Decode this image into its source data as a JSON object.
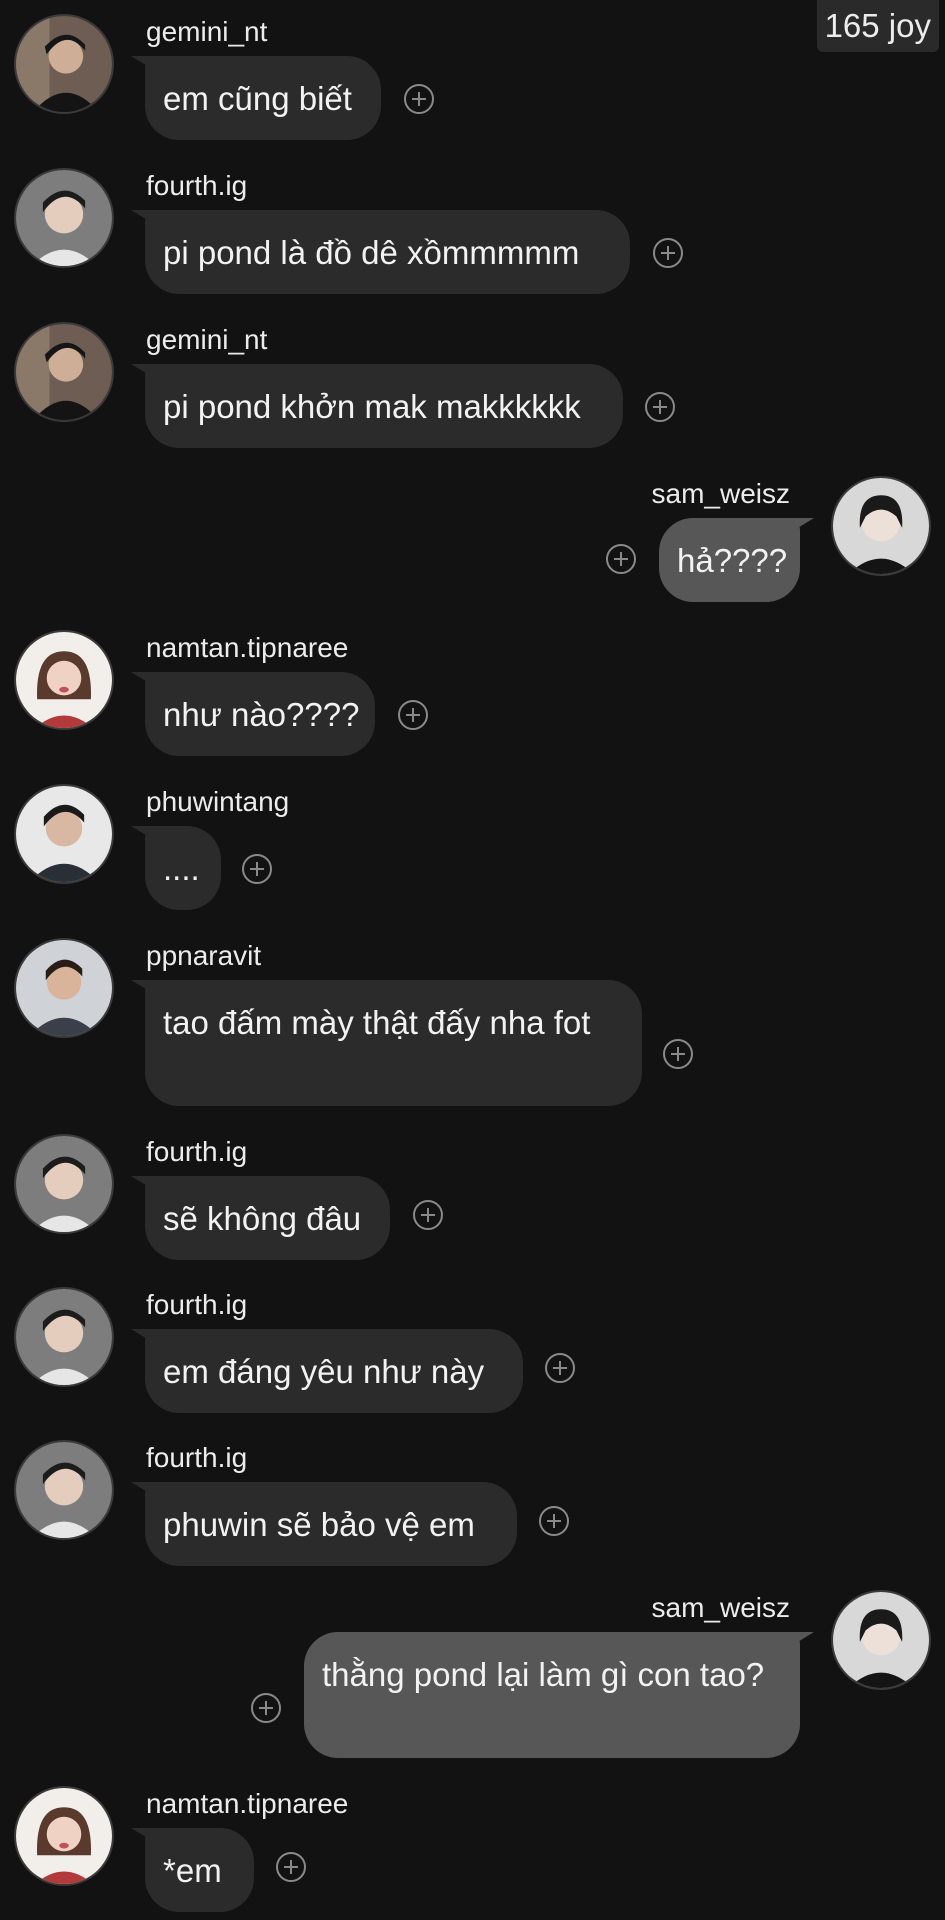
{
  "badge": "165 joy",
  "messages": [
    {
      "user": "gemini_nt",
      "text": "em cũng biết"
    },
    {
      "user": "fourth.ig",
      "text": "pi pond là đồ dê xồmmmmm"
    },
    {
      "user": "gemini_nt",
      "text": "pi pond khởn mak makkkkkk"
    },
    {
      "user": "sam_weisz",
      "text": "hả????"
    },
    {
      "user": "namtan.tipnaree",
      "text": "như nào????"
    },
    {
      "user": "phuwintang",
      "text": "...."
    },
    {
      "user": "ppnaravit",
      "text": "tao đấm mày thật đấy nha fot"
    },
    {
      "user": "fourth.ig",
      "text": "sẽ không đâu"
    },
    {
      "user": "fourth.ig",
      "text": "em đáng yêu như này"
    },
    {
      "user": "fourth.ig",
      "text": "phuwin sẽ bảo vệ em"
    },
    {
      "user": "sam_weisz",
      "text": "thằng pond lại làm gì con tao?"
    },
    {
      "user": "namtan.tipnaree",
      "text": "*em"
    }
  ]
}
